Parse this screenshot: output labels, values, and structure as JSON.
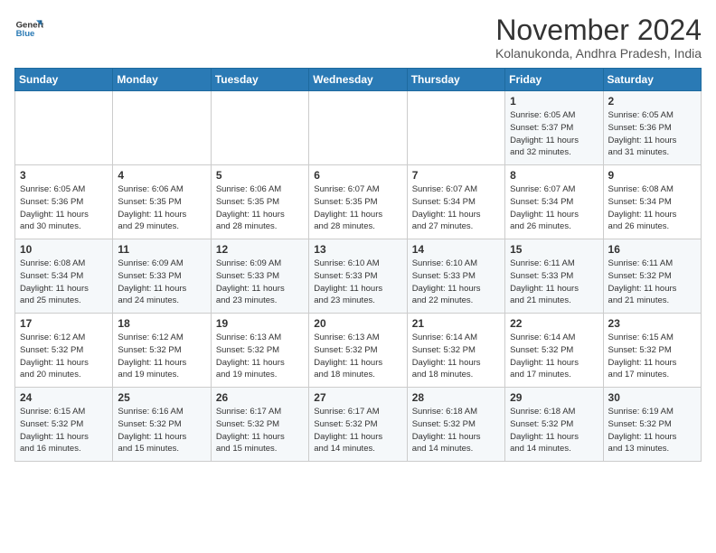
{
  "header": {
    "logo_line1": "General",
    "logo_line2": "Blue",
    "month_year": "November 2024",
    "location": "Kolanukonda, Andhra Pradesh, India"
  },
  "weekdays": [
    "Sunday",
    "Monday",
    "Tuesday",
    "Wednesday",
    "Thursday",
    "Friday",
    "Saturday"
  ],
  "weeks": [
    [
      {
        "day": "",
        "info": ""
      },
      {
        "day": "",
        "info": ""
      },
      {
        "day": "",
        "info": ""
      },
      {
        "day": "",
        "info": ""
      },
      {
        "day": "",
        "info": ""
      },
      {
        "day": "1",
        "info": "Sunrise: 6:05 AM\nSunset: 5:37 PM\nDaylight: 11 hours\nand 32 minutes."
      },
      {
        "day": "2",
        "info": "Sunrise: 6:05 AM\nSunset: 5:36 PM\nDaylight: 11 hours\nand 31 minutes."
      }
    ],
    [
      {
        "day": "3",
        "info": "Sunrise: 6:05 AM\nSunset: 5:36 PM\nDaylight: 11 hours\nand 30 minutes."
      },
      {
        "day": "4",
        "info": "Sunrise: 6:06 AM\nSunset: 5:35 PM\nDaylight: 11 hours\nand 29 minutes."
      },
      {
        "day": "5",
        "info": "Sunrise: 6:06 AM\nSunset: 5:35 PM\nDaylight: 11 hours\nand 28 minutes."
      },
      {
        "day": "6",
        "info": "Sunrise: 6:07 AM\nSunset: 5:35 PM\nDaylight: 11 hours\nand 28 minutes."
      },
      {
        "day": "7",
        "info": "Sunrise: 6:07 AM\nSunset: 5:34 PM\nDaylight: 11 hours\nand 27 minutes."
      },
      {
        "day": "8",
        "info": "Sunrise: 6:07 AM\nSunset: 5:34 PM\nDaylight: 11 hours\nand 26 minutes."
      },
      {
        "day": "9",
        "info": "Sunrise: 6:08 AM\nSunset: 5:34 PM\nDaylight: 11 hours\nand 26 minutes."
      }
    ],
    [
      {
        "day": "10",
        "info": "Sunrise: 6:08 AM\nSunset: 5:34 PM\nDaylight: 11 hours\nand 25 minutes."
      },
      {
        "day": "11",
        "info": "Sunrise: 6:09 AM\nSunset: 5:33 PM\nDaylight: 11 hours\nand 24 minutes."
      },
      {
        "day": "12",
        "info": "Sunrise: 6:09 AM\nSunset: 5:33 PM\nDaylight: 11 hours\nand 23 minutes."
      },
      {
        "day": "13",
        "info": "Sunrise: 6:10 AM\nSunset: 5:33 PM\nDaylight: 11 hours\nand 23 minutes."
      },
      {
        "day": "14",
        "info": "Sunrise: 6:10 AM\nSunset: 5:33 PM\nDaylight: 11 hours\nand 22 minutes."
      },
      {
        "day": "15",
        "info": "Sunrise: 6:11 AM\nSunset: 5:33 PM\nDaylight: 11 hours\nand 21 minutes."
      },
      {
        "day": "16",
        "info": "Sunrise: 6:11 AM\nSunset: 5:32 PM\nDaylight: 11 hours\nand 21 minutes."
      }
    ],
    [
      {
        "day": "17",
        "info": "Sunrise: 6:12 AM\nSunset: 5:32 PM\nDaylight: 11 hours\nand 20 minutes."
      },
      {
        "day": "18",
        "info": "Sunrise: 6:12 AM\nSunset: 5:32 PM\nDaylight: 11 hours\nand 19 minutes."
      },
      {
        "day": "19",
        "info": "Sunrise: 6:13 AM\nSunset: 5:32 PM\nDaylight: 11 hours\nand 19 minutes."
      },
      {
        "day": "20",
        "info": "Sunrise: 6:13 AM\nSunset: 5:32 PM\nDaylight: 11 hours\nand 18 minutes."
      },
      {
        "day": "21",
        "info": "Sunrise: 6:14 AM\nSunset: 5:32 PM\nDaylight: 11 hours\nand 18 minutes."
      },
      {
        "day": "22",
        "info": "Sunrise: 6:14 AM\nSunset: 5:32 PM\nDaylight: 11 hours\nand 17 minutes."
      },
      {
        "day": "23",
        "info": "Sunrise: 6:15 AM\nSunset: 5:32 PM\nDaylight: 11 hours\nand 17 minutes."
      }
    ],
    [
      {
        "day": "24",
        "info": "Sunrise: 6:15 AM\nSunset: 5:32 PM\nDaylight: 11 hours\nand 16 minutes."
      },
      {
        "day": "25",
        "info": "Sunrise: 6:16 AM\nSunset: 5:32 PM\nDaylight: 11 hours\nand 15 minutes."
      },
      {
        "day": "26",
        "info": "Sunrise: 6:17 AM\nSunset: 5:32 PM\nDaylight: 11 hours\nand 15 minutes."
      },
      {
        "day": "27",
        "info": "Sunrise: 6:17 AM\nSunset: 5:32 PM\nDaylight: 11 hours\nand 14 minutes."
      },
      {
        "day": "28",
        "info": "Sunrise: 6:18 AM\nSunset: 5:32 PM\nDaylight: 11 hours\nand 14 minutes."
      },
      {
        "day": "29",
        "info": "Sunrise: 6:18 AM\nSunset: 5:32 PM\nDaylight: 11 hours\nand 14 minutes."
      },
      {
        "day": "30",
        "info": "Sunrise: 6:19 AM\nSunset: 5:32 PM\nDaylight: 11 hours\nand 13 minutes."
      }
    ]
  ]
}
